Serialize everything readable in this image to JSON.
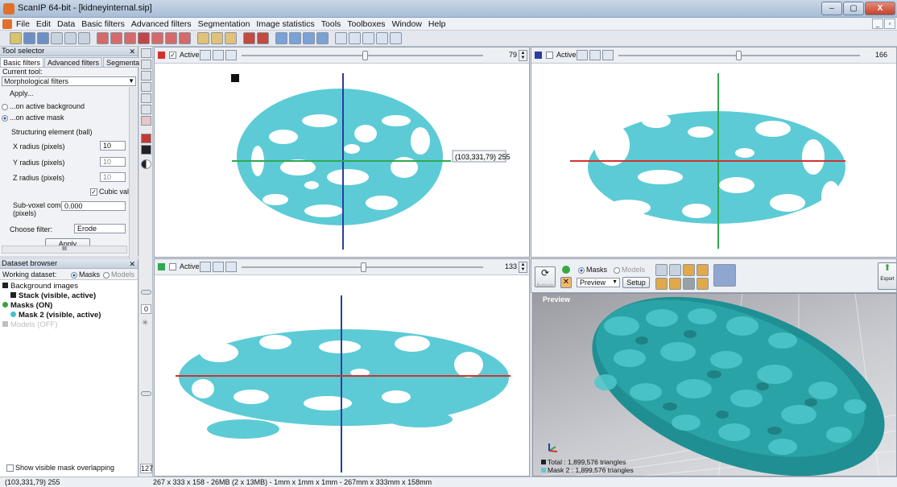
{
  "window": {
    "title": "ScanIP 64-bit - [kidneyinternal.sip]",
    "minimize": "–",
    "maximize": "▢",
    "close": "X"
  },
  "menu": [
    "File",
    "Edit",
    "Data",
    "Basic filters",
    "Advanced filters",
    "Segmentation",
    "Image statistics",
    "Tools",
    "Toolboxes",
    "Window",
    "Help"
  ],
  "tool_selector": {
    "title": "Tool selector",
    "tabs": [
      "Basic filters",
      "Advanced filters",
      "Segmentation"
    ],
    "current_tool_label": "Current tool:",
    "current_tool": "Morphological filters",
    "apply_heading": "Apply...",
    "apply_options": [
      "...on active background",
      "...on active mask"
    ],
    "structuring_element": "Structuring element (ball)",
    "x_radius_label": "X radius (pixels)",
    "x_radius": "10",
    "y_radius_label": "Y radius (pixels)",
    "y_radius": "10",
    "z_radius_label": "Z radius (pixels)",
    "z_radius": "10",
    "cubic_label": "Cubic valu",
    "subvoxel_label": "Sub-voxel component",
    "subvoxel_unit": "(pixels)",
    "subvoxel_value": "0.000",
    "filter_label": "Choose filter:",
    "filter_value": "Erode",
    "apply_button": "Apply",
    "hscroll_mark": "III"
  },
  "dataset_browser": {
    "title": "Dataset browser",
    "working_label": "Working dataset:",
    "masks_option": "Masks",
    "models_option": "Models",
    "tree": [
      {
        "label": "Background images",
        "bold": false,
        "indent": 0,
        "color": "#222222"
      },
      {
        "label": "Stack (visible, active)",
        "bold": true,
        "indent": 1,
        "color": "#222222"
      },
      {
        "label": "Masks (ON)",
        "bold": true,
        "indent": 0,
        "color": "#3aa23a"
      },
      {
        "label": "Mask 2 (visible, active)",
        "bold": true,
        "indent": 1,
        "color": "#46c0d0"
      },
      {
        "label": "Models (OFF)",
        "bold": false,
        "indent": 0,
        "color": "#bfbfbf"
      }
    ],
    "show_overlap": "Show visible mask overlapping"
  },
  "sidestrip": {
    "value_top": "0",
    "value_bottom": "127"
  },
  "viewports": {
    "top_left": {
      "active_label": "Active",
      "slice": "79",
      "marker_color": "#d2322d",
      "cursor_readout": "(103,331,79) 255"
    },
    "top_right": {
      "active_label": "Active",
      "slice": "166",
      "marker_color": "#2b3da0"
    },
    "bottom_left": {
      "active_label": "Active",
      "slice": "133",
      "marker_color": "#2fa84f"
    }
  },
  "preview": {
    "refresh_label": "Refresh",
    "masks_option": "Masks",
    "models_option": "Models",
    "preview_combo": "Preview",
    "setup_button": "Setup",
    "export_label": "Export",
    "title": "Preview",
    "total_triangles": "Total : 1,899,576 triangles",
    "mask_triangles": "Mask 2 : 1,899,576 triangles"
  },
  "status": {
    "coords": "(103,331,79) 255",
    "info": "267 x 333 x 158  -  26MB (2 x 13MB)  -  1mm x 1mm x 1mm  -  267mm x 333mm x 158mm"
  },
  "colors": {
    "mask": "#5ccbd6",
    "model": "#2aa3a6",
    "crosshair_red": "#d2322d",
    "crosshair_blue": "#2b3da0",
    "crosshair_green": "#2fa84f"
  }
}
